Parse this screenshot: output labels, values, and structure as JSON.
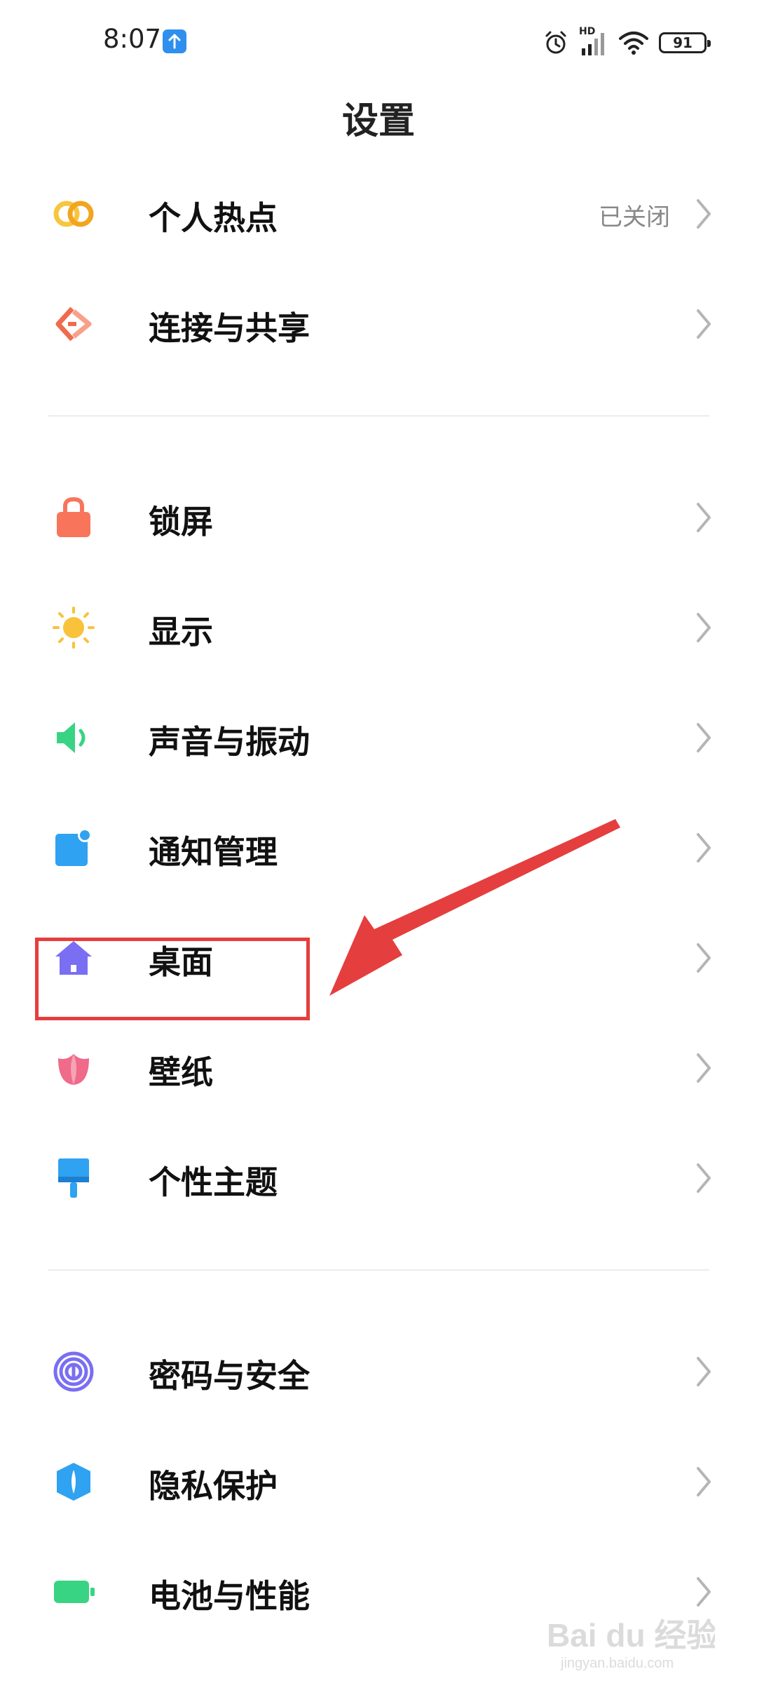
{
  "status_bar": {
    "time": "8:07",
    "battery": "91",
    "network_label": "HD"
  },
  "page_title": "设置",
  "sections": [
    {
      "items": [
        {
          "label": "个人热点",
          "value": "已关闭",
          "icon": "hotspot-icon",
          "color": "#f7c53f"
        },
        {
          "label": "连接与共享",
          "icon": "connection-share-icon",
          "color": "#f06b4c"
        }
      ]
    },
    {
      "items": [
        {
          "label": "锁屏",
          "icon": "lock-icon",
          "color": "#f8755c"
        },
        {
          "label": "显示",
          "icon": "sun-icon",
          "color": "#f8c33a"
        },
        {
          "label": "声音与振动",
          "icon": "speaker-icon",
          "color": "#38d483"
        },
        {
          "label": "通知管理",
          "icon": "notification-icon",
          "color": "#2fa2f1"
        },
        {
          "label": "桌面",
          "icon": "home-icon",
          "color": "#7a6ef2"
        },
        {
          "label": "壁纸",
          "icon": "flower-icon",
          "color": "#f06a8a"
        },
        {
          "label": "个性主题",
          "icon": "brush-icon",
          "color": "#2fa2f1"
        }
      ]
    },
    {
      "items": [
        {
          "label": "密码与安全",
          "icon": "fingerprint-icon",
          "color": "#7a6ef2"
        },
        {
          "label": "隐私保护",
          "icon": "privacy-shield-icon",
          "color": "#2fa2f1"
        },
        {
          "label": "电池与性能",
          "icon": "battery-icon",
          "color": "#38d483"
        }
      ]
    }
  ],
  "annotation": {
    "color": "#e53e3e"
  },
  "watermark": {
    "text": "Bai du 经验",
    "subtext": "jingyan.baidu.com"
  }
}
